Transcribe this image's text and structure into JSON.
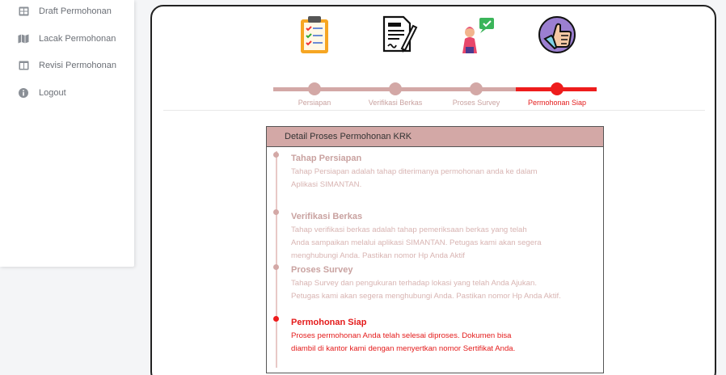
{
  "sidebar": {
    "items": [
      {
        "label": "Draft Permohonan",
        "icon": "table-grid-icon"
      },
      {
        "label": "Lacak Permohonan",
        "icon": "map-icon"
      },
      {
        "label": "Revisi Permohonan",
        "icon": "columns-icon"
      },
      {
        "label": "Logout",
        "icon": "info-circle-icon"
      }
    ]
  },
  "steps": [
    {
      "label": "Persiapan",
      "icon": "clipboard-checklist-icon",
      "active": false
    },
    {
      "label": "Verifikasi Berkas",
      "icon": "document-pen-icon",
      "active": false
    },
    {
      "label": "Proses Survey",
      "icon": "person-chat-icon",
      "active": false
    },
    {
      "label": "Permohonan Siap",
      "icon": "thumbs-up-icon",
      "active": true
    }
  ],
  "detail": {
    "header": "Detail Proses Permohonan KRK",
    "items": [
      {
        "title": "Tahap Persiapan",
        "lines": [
          "Tahap Persiapan adalah tahap diterimanya permohonan anda ke dalam",
          "Aplikasi SIMANTAN."
        ],
        "active": false
      },
      {
        "title": "Verifikasi Berkas",
        "lines": [
          "Tahap verifikasi berkas adalah tahap pemeriksaan berkas yang telah",
          "Anda sampaikan melalui aplikasi SIMANTAN. Petugas kami akan segera",
          "menghubungi Anda. Pastikan nomor Hp Anda Aktif"
        ],
        "active": false
      },
      {
        "title": "Proses Survey",
        "lines": [
          "Tahap Survey dan pengukuran terhadap lokasi yang telah Anda Ajukan.",
          "Petugas kami akan segera menghubungi Anda. Pastikan nomor Hp Anda Aktif."
        ],
        "active": false
      },
      {
        "title": "Permohonan Siap",
        "lines": [
          "Proses permohonan Anda telah selesai diproses. Dokumen bisa",
          "diambil di kantor kami dengan menyertkan nomor Sertifikat Anda."
        ],
        "active": true
      }
    ]
  },
  "colors": {
    "inactive": "#d3a8a6",
    "active": "#ee1c1c",
    "inactive_text": "#c9a2a0",
    "active_text": "#e41b1b",
    "header_bg": "#d3a8a6"
  }
}
